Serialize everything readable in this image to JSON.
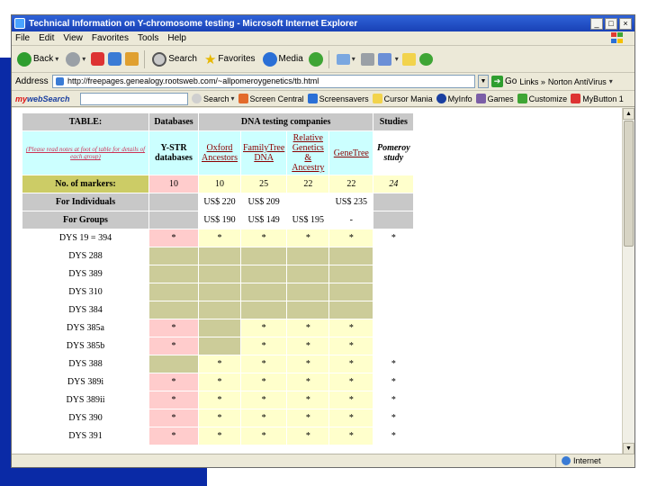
{
  "window": {
    "title": "Technical Information on Y-chromosome testing - Microsoft Internet Explorer",
    "min": "_",
    "max": "□",
    "close": "×"
  },
  "menu": [
    "File",
    "Edit",
    "View",
    "Favorites",
    "Tools",
    "Help"
  ],
  "toolbar": {
    "back": "Back",
    "search": "Search",
    "favorites": "Favorites",
    "media": "Media"
  },
  "address": {
    "label": "Address",
    "url": "http://freepages.genealogy.rootsweb.com/~allpomeroygenetics/tb.html",
    "go": "Go",
    "links": "Links »",
    "norton": "Norton AntiVirus"
  },
  "searchbar": {
    "logo_my": "my",
    "logo_ws": "webSearch",
    "search_btn": "Search",
    "items": [
      "Screen Central",
      "Screensavers",
      "Cursor Mania",
      "MyInfo",
      "Games",
      "Customize",
      "MyButton 1"
    ]
  },
  "status": {
    "text": "",
    "zone": "Internet"
  },
  "colors": {
    "slide_blue": "#0a2aa6",
    "gold": "#cccc66",
    "pink": "#ffcccc",
    "olive": "#cccc99",
    "cream": "#ffffcc",
    "cyan": "#ccffff",
    "grey": "#c8c8c8"
  },
  "table": {
    "h_table": "TABLE:",
    "h_databases": "Databases",
    "h_companies": "DNA testing companies",
    "h_studies": "Studies",
    "note": "(Please read notes at foot of table for details of each group)",
    "ystr": "Y-STR",
    "ystr2": "databases",
    "oxford": "Oxford",
    "oxford2": "Ancestors",
    "ftdna": "FamilyTree",
    "ftdna2": "DNA",
    "relative": "Relative",
    "relative2": "Genetics",
    "relative3": "&",
    "relative4": "Ancestry",
    "genetree": "GeneTree",
    "pomeroy": "Pomeroy",
    "pomeroy2": "study",
    "markers_label": "No. of markers:",
    "markers": [
      "10",
      "10",
      "25",
      "22",
      "22",
      "24"
    ],
    "individuals_label": "For Individuals",
    "individuals": [
      "",
      "US$ 220",
      "US$ 209",
      "",
      "US$ 235"
    ],
    "groups_label": "For Groups",
    "groups": [
      "",
      "US$ 190",
      "US$ 149",
      "US$ 195",
      "-"
    ],
    "rows": [
      {
        "label": "DYS 19 = 394",
        "cells": [
          "*",
          "*",
          "*",
          "*",
          "*",
          "*"
        ]
      },
      {
        "label": "DYS 288",
        "cells": [
          "",
          "",
          "",
          "",
          "",
          ""
        ]
      },
      {
        "label": "DYS 389",
        "cells": [
          "",
          "",
          "",
          "",
          "",
          ""
        ]
      },
      {
        "label": "DYS 310",
        "cells": [
          "",
          "",
          "",
          "",
          "",
          ""
        ]
      },
      {
        "label": "DYS 384",
        "cells": [
          "",
          "",
          "",
          "",
          "",
          ""
        ]
      },
      {
        "label": "DYS 385a",
        "cells": [
          "*",
          "",
          "*",
          "*",
          "*",
          ""
        ]
      },
      {
        "label": "DYS 385b",
        "cells": [
          "*",
          "",
          "*",
          "*",
          "*",
          ""
        ]
      },
      {
        "label": "DYS 388",
        "cells": [
          "",
          "*",
          "*",
          "*",
          "*",
          "*"
        ]
      },
      {
        "label": "DYS 389i",
        "cells": [
          "*",
          "*",
          "*",
          "*",
          "*",
          "*"
        ]
      },
      {
        "label": "DYS 389ii",
        "cells": [
          "*",
          "*",
          "*",
          "*",
          "*",
          "*"
        ]
      },
      {
        "label": "DYS 390",
        "cells": [
          "*",
          "*",
          "*",
          "*",
          "*",
          "*"
        ]
      },
      {
        "label": "DYS 391",
        "cells": [
          "*",
          "*",
          "*",
          "*",
          "*",
          "*"
        ]
      }
    ]
  }
}
